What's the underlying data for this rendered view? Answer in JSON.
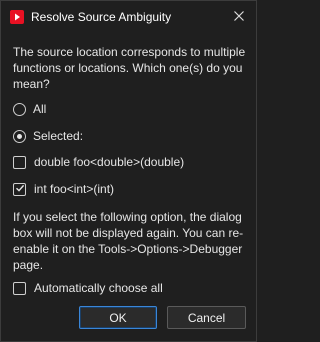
{
  "window": {
    "title": "Resolve Source Ambiguity",
    "app_icon": "visual-studio-icon",
    "close_icon": "close-icon"
  },
  "question": "The source location corresponds to multiple functions or locations. Which one(s) do you mean?",
  "scope": {
    "selected_value": "selected",
    "options": [
      {
        "id": "all",
        "label": "All",
        "selected": false
      },
      {
        "id": "selected",
        "label": "Selected:",
        "selected": true
      }
    ]
  },
  "locations": [
    {
      "label": "double foo<double>(double)",
      "checked": false
    },
    {
      "label": "int foo<int>(int)",
      "checked": true
    }
  ],
  "note": "If you select the following option, the dialog box will not be displayed again. You can re-enable it on the Tools->Options->Debugger page.",
  "auto_choose": {
    "label": "Automatically choose all",
    "checked": false
  },
  "buttons": {
    "ok": "OK",
    "cancel": "Cancel"
  },
  "colors": {
    "background": "#1f1f1f",
    "accent": "#3a86d8",
    "icon_red": "#e81123"
  }
}
